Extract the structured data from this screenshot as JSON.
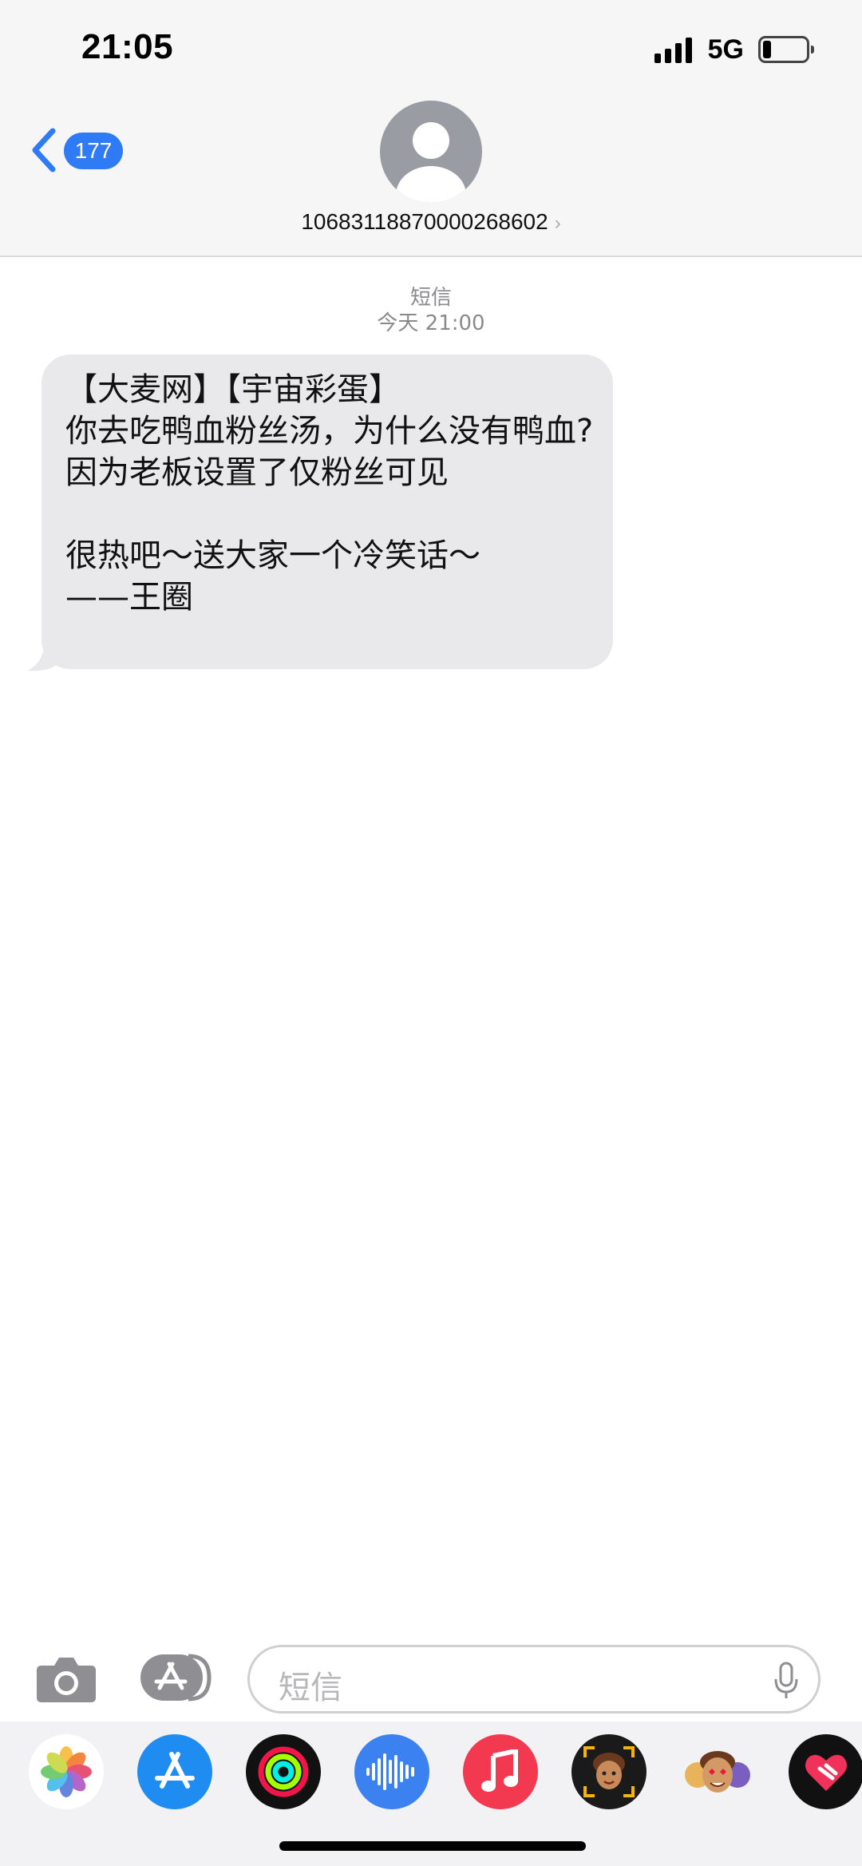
{
  "status_bar": {
    "time": "21:05",
    "network": "5G"
  },
  "nav": {
    "back_count": "177",
    "contact": "10683118870000268602"
  },
  "conversation": {
    "kind": "短信",
    "timestamp": "今天 21:00",
    "messages": [
      {
        "text": "【大麦网】【宇宙彩蛋】\n你去吃鸭血粉丝汤，为什么没有鸭血?\n因为老板设置了仅粉丝可见\n\n很热吧～送大家一个冷笑话～\n——王圈"
      }
    ]
  },
  "composer": {
    "placeholder": "短信"
  },
  "app_drawer": {
    "apps": [
      {
        "name": "photos-app-icon"
      },
      {
        "name": "app-store-app-icon"
      },
      {
        "name": "fitness-app-icon"
      },
      {
        "name": "audio-message-app-icon"
      },
      {
        "name": "music-app-icon"
      },
      {
        "name": "memoji-app-icon"
      },
      {
        "name": "animoji-stickers-app-icon"
      },
      {
        "name": "digital-touch-app-icon"
      }
    ]
  },
  "colors": {
    "accent": "#2f7af5",
    "bubble": "#e9e9eb",
    "header_bg": "#f6f6f6"
  }
}
